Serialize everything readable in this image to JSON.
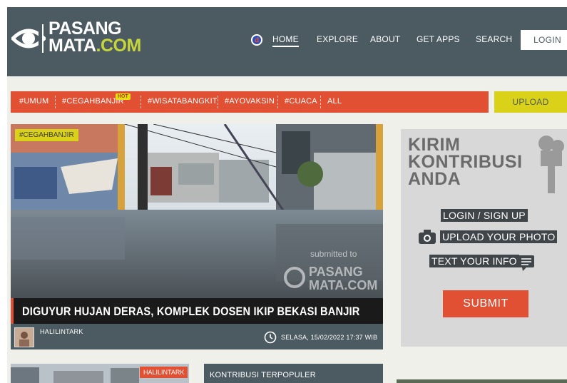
{
  "brand": {
    "line1": "PASANG",
    "line2": "MATA",
    "dot": ".COM"
  },
  "nav": {
    "home": "HOME",
    "explore": "EXPLORE",
    "about": "ABOUT",
    "get_apps": "GET APPS",
    "search": "SEARCH",
    "login": "LOGIN"
  },
  "tags": [
    "#UMUM",
    "#CEGAHBANJIR",
    "#WISATABANGKIT",
    "#AYOVAKSIN",
    "#CUACA",
    "ALL"
  ],
  "hot_badge": "HOT",
  "upload": "UPLOAD",
  "hero": {
    "tag": "#CEGAHBANJIR",
    "title": "DIGUYUR HUJAN DERAS, KOMPLEK DOSEN IKIP BEKASI BANJIR",
    "author": "HALILINTARK",
    "date": "SELASA, 15/02/2022 17:37 WIB",
    "watermark_top": "submitted to",
    "watermark_brand1": "PASANG",
    "watermark_brand2": "MATA.COM"
  },
  "promo": {
    "title_line1": "KIRIM",
    "title_line2": "KONTRIBUSI",
    "title_line3": "ANDA",
    "step1": "LOGIN / SIGN UP",
    "step2": "UPLOAD YOUR PHOTO",
    "step3": "TEXT YOUR INFO",
    "submit": "SUBMIT"
  },
  "bottom": {
    "thumb_label": "HALILINTARK",
    "populer_title": "KONTRIBUSI TERPOPULER"
  },
  "colors": {
    "header": "#4c5a61",
    "accent_red": "#e25033",
    "accent_yellow": "#d9d219"
  }
}
